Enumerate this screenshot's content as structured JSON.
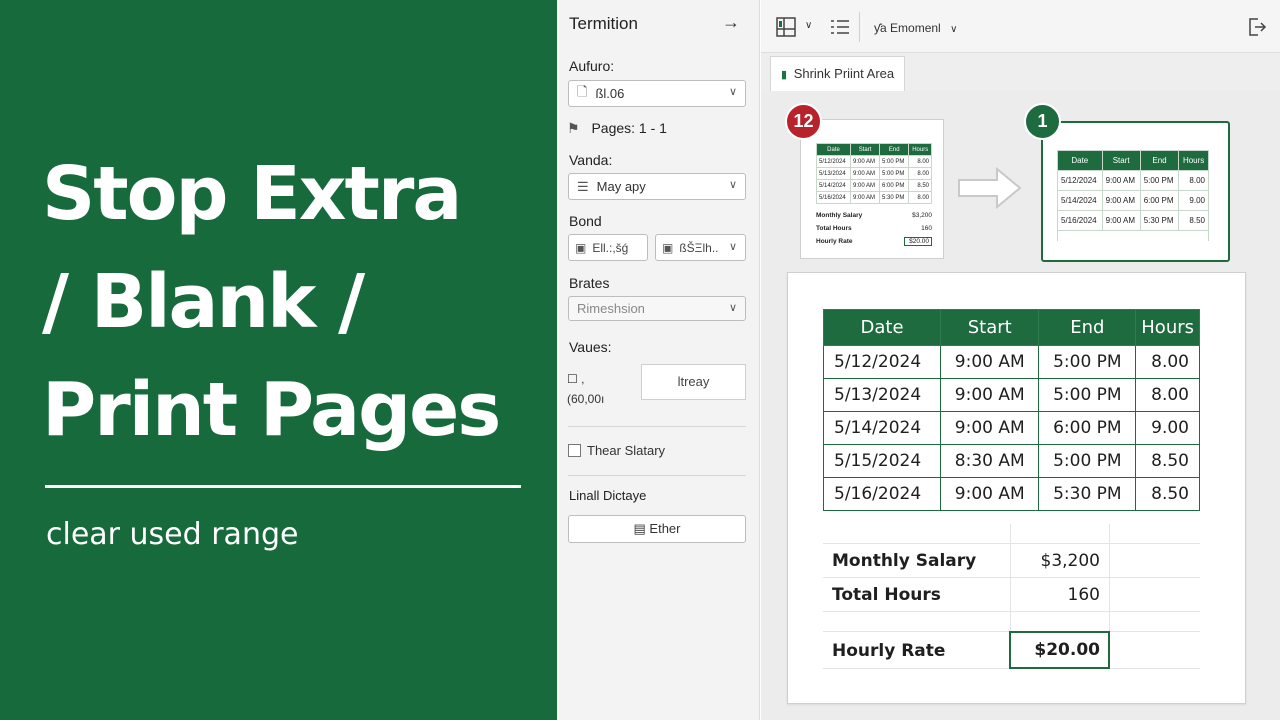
{
  "banner": {
    "title_lines": [
      "Stop Extra",
      "/ Blank /",
      "Print Pages"
    ],
    "subtitle": "clear used range",
    "bg_color": "#166a3c"
  },
  "panel": {
    "header": "Termition",
    "header_arrow": "→",
    "aufuro_label": "Aufuro:",
    "aufuro_value": "ßl.06",
    "pages_text": "Pages: 1 - 1",
    "vanda_label": "Vanda:",
    "vanda_value": "May apy",
    "bond_label": "Bond",
    "bond_left": "Ell.:,šǵ",
    "bond_right": "ßŠΞlh..",
    "brates_label": "Brates",
    "brates_value": "Rimeshsion",
    "values_label": "Vaues:",
    "values_glyph": ",",
    "values_number": "(60,00ı",
    "values_button": "ltreay",
    "checkbox_label": "Thear Slatary",
    "linall_label": "Linall Dictaye",
    "ether_button": "Ether"
  },
  "toolbar": {
    "dropdown_label": "Emomenl",
    "dropdown_prefix": "ƴa"
  },
  "tab": {
    "label": "Shrink Priint Area"
  },
  "badges": {
    "left": "12",
    "right": "1",
    "left_color": "#b8222a",
    "right_color": "#1d6b3e"
  },
  "mini_left": {
    "headers": [
      "Date",
      "Start",
      "End",
      "Hours"
    ],
    "rows": [
      [
        "5/12/2024",
        "9:00 AM",
        "5:00 PM",
        "8.00"
      ],
      [
        "5/13/2024",
        "9:00 AM",
        "5:00 PM",
        "8.00"
      ],
      [
        "5/14/2024",
        "9:00 AM",
        "6:00 PM",
        "8.50"
      ],
      [
        "5/16/2024",
        "9:00 AM",
        "5:30 PM",
        "8.00"
      ]
    ],
    "summary": [
      {
        "label": "Monthly Salary",
        "value": "$3,200"
      },
      {
        "label": "Total Hours",
        "value": "160"
      },
      {
        "label": "Hourly Rate",
        "value": "$20.00"
      }
    ]
  },
  "mini_right": {
    "headers": [
      "Date",
      "Start",
      "End",
      "Hours"
    ],
    "rows": [
      [
        "5/12/2024",
        "9:00 AM",
        "5:00 PM",
        "8.00"
      ],
      [
        "5/14/2024",
        "9:00 AM",
        "6:00 PM",
        "9.00"
      ],
      [
        "5/16/2024",
        "9:00 AM",
        "5:30 PM",
        "8.50"
      ]
    ]
  },
  "main_table": {
    "headers": [
      "Date",
      "Start",
      "End",
      "Hours"
    ],
    "rows": [
      [
        "5/12/2024",
        "9:00 AM",
        "5:00 PM",
        "8.00"
      ],
      [
        "5/13/2024",
        "9:00 AM",
        "5:00 PM",
        "8.00"
      ],
      [
        "5/14/2024",
        "9:00 AM",
        "6:00 PM",
        "9.00"
      ],
      [
        "5/15/2024",
        "8:30 AM",
        "5:00 PM",
        "8.50"
      ],
      [
        "5/16/2024",
        "9:00 AM",
        "5:30 PM",
        "8.50"
      ]
    ],
    "summary": {
      "salary_label": "Monthly Salary",
      "salary_value": "$3,200",
      "hours_label": "Total Hours",
      "hours_value": "160",
      "rate_label": "Hourly Rate",
      "rate_value": "$20.00"
    }
  },
  "accent_color": "#1d6b3e"
}
